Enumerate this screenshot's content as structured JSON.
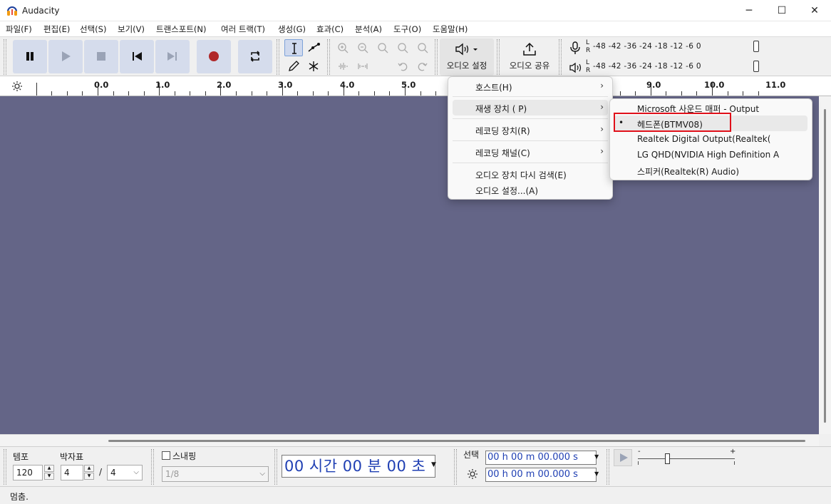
{
  "window": {
    "title": "Audacity",
    "minimize": "─",
    "maximize": "☐",
    "close": "✕"
  },
  "menubar": [
    "파일(F)",
    "편집(E)",
    "선택(S)",
    "보기(V)",
    "트랜스포트(N)",
    "여러 트랙(T)",
    "생성(G)",
    "효과(C)",
    "분석(A)",
    "도구(O)",
    "도움말(H)"
  ],
  "toolbar": {
    "audio_setup_label": "오디오 설정",
    "share_audio_label": "오디오 공유",
    "meter_channels": [
      "L",
      "R"
    ],
    "meter_scale": "-48 -42 -36  -24 -18 -12  -6  0"
  },
  "timeline": {
    "ticks": [
      "0.0",
      "1.0",
      "2.0",
      "3.0",
      "4.0",
      "5.0",
      "9.0",
      "10.0",
      "11.0"
    ]
  },
  "audio_setup_menu": {
    "items": [
      {
        "label": "호스트(H)",
        "submenu": true
      },
      {
        "label": "재생 장치 ( P)",
        "submenu": true,
        "highlighted": true
      },
      {
        "label": "레코딩 장치(R)",
        "submenu": true
      },
      {
        "label": "레코딩 채널(C)",
        "submenu": true
      },
      {
        "label": "오디오 장치 다시 검색(E)",
        "submenu": false
      },
      {
        "label": "오디오 설정...(A)",
        "submenu": false
      }
    ]
  },
  "playback_device_menu": {
    "items": [
      {
        "label": "Microsoft 사운드 매퍼 - Output",
        "selected": false
      },
      {
        "label": "헤드폰(BTMV08)",
        "selected": true
      },
      {
        "label": "Realtek Digital Output(Realtek(",
        "selected": false
      },
      {
        "label": "LG QHD(NVIDIA High Definition A",
        "selected": false
      },
      {
        "label": "스피커(Realtek(R) Audio)",
        "selected": false
      }
    ],
    "selected_bullet": "•"
  },
  "bottom": {
    "tempo_label": "템포",
    "tempo_value": "120",
    "time_sig_label": "박자표",
    "time_sig_num": "4",
    "time_sig_slash": "/",
    "time_sig_den": "4",
    "snapping_label": "스내핑",
    "snap_value": "1/8",
    "time_display": "00 시간 00 분 00 초",
    "selection_label": "선택",
    "selection_start": "00 h 00 m 00.000 s",
    "selection_end": "00 h 00 m 00.000 s",
    "speed_min": "-",
    "speed_max": "+",
    "speed_fraction": 0.3
  },
  "status": {
    "text": "멈춤."
  },
  "colors": {
    "track_bg": "#646587",
    "button_bg": "#d5dcec",
    "highlight_red": "#e0101a",
    "time_blue": "#1f3fb3",
    "record_red": "#b0282a"
  }
}
